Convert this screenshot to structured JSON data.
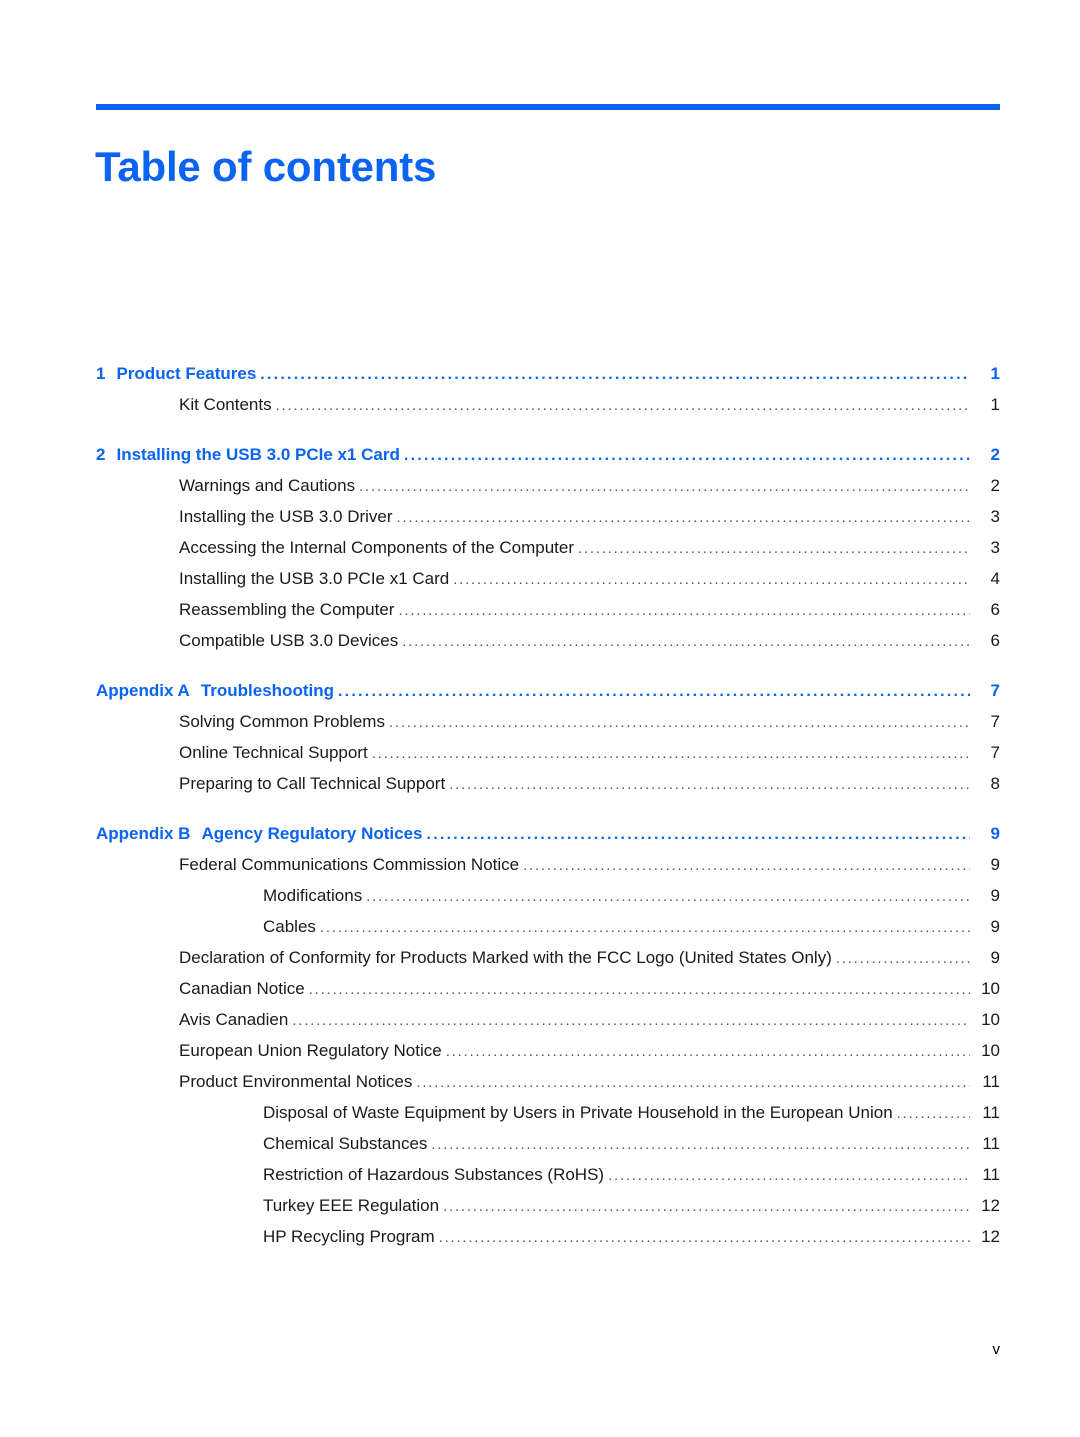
{
  "document": {
    "title": "Table of contents",
    "accent_color": "#0a63f2",
    "footer_page_number": "v"
  },
  "toc": {
    "entries": [
      {
        "level": 1,
        "number": "1",
        "label": "Product Features",
        "page": "1"
      },
      {
        "level": 2,
        "number": "",
        "label": "Kit Contents",
        "page": "1"
      },
      {
        "level": 1,
        "number": "2",
        "label": "Installing the USB 3.0 PCIe x1 Card",
        "page": "2"
      },
      {
        "level": 2,
        "number": "",
        "label": "Warnings and Cautions",
        "page": "2"
      },
      {
        "level": 2,
        "number": "",
        "label": "Installing the USB 3.0 Driver",
        "page": "3"
      },
      {
        "level": 2,
        "number": "",
        "label": "Accessing the Internal Components of the Computer",
        "page": "3"
      },
      {
        "level": 2,
        "number": "",
        "label": "Installing the USB 3.0 PCIe x1 Card",
        "page": "4"
      },
      {
        "level": 2,
        "number": "",
        "label": "Reassembling the Computer",
        "page": "6"
      },
      {
        "level": 2,
        "number": "",
        "label": "Compatible USB 3.0 Devices",
        "page": "6"
      },
      {
        "level": 1,
        "number": "Appendix A",
        "label": "Troubleshooting",
        "page": "7"
      },
      {
        "level": 2,
        "number": "",
        "label": "Solving Common Problems",
        "page": "7"
      },
      {
        "level": 2,
        "number": "",
        "label": "Online Technical Support",
        "page": "7"
      },
      {
        "level": 2,
        "number": "",
        "label": "Preparing to Call Technical Support",
        "page": "8"
      },
      {
        "level": 1,
        "number": "Appendix B",
        "label": "Agency Regulatory Notices",
        "page": "9"
      },
      {
        "level": 2,
        "number": "",
        "label": "Federal Communications Commission Notice",
        "page": "9"
      },
      {
        "level": 3,
        "number": "",
        "label": "Modifications",
        "page": "9"
      },
      {
        "level": 3,
        "number": "",
        "label": "Cables",
        "page": "9"
      },
      {
        "level": 2,
        "number": "",
        "label": "Declaration of Conformity for Products Marked with the FCC Logo (United States Only)",
        "page": "9"
      },
      {
        "level": 2,
        "number": "",
        "label": "Canadian Notice",
        "page": "10"
      },
      {
        "level": 2,
        "number": "",
        "label": "Avis Canadien",
        "page": "10"
      },
      {
        "level": 2,
        "number": "",
        "label": "European Union Regulatory Notice",
        "page": "10"
      },
      {
        "level": 2,
        "number": "",
        "label": "Product Environmental Notices",
        "page": "11"
      },
      {
        "level": 3,
        "number": "",
        "label": "Disposal of Waste Equipment by Users in Private Household in the European Union",
        "page": "11"
      },
      {
        "level": 3,
        "number": "",
        "label": "Chemical Substances",
        "page": "11"
      },
      {
        "level": 3,
        "number": "",
        "label": "Restriction of Hazardous Substances (RoHS)",
        "page": "11"
      },
      {
        "level": 3,
        "number": "",
        "label": "Turkey EEE Regulation",
        "page": "12"
      },
      {
        "level": 3,
        "number": "",
        "label": "HP Recycling Program",
        "page": "12"
      }
    ]
  }
}
